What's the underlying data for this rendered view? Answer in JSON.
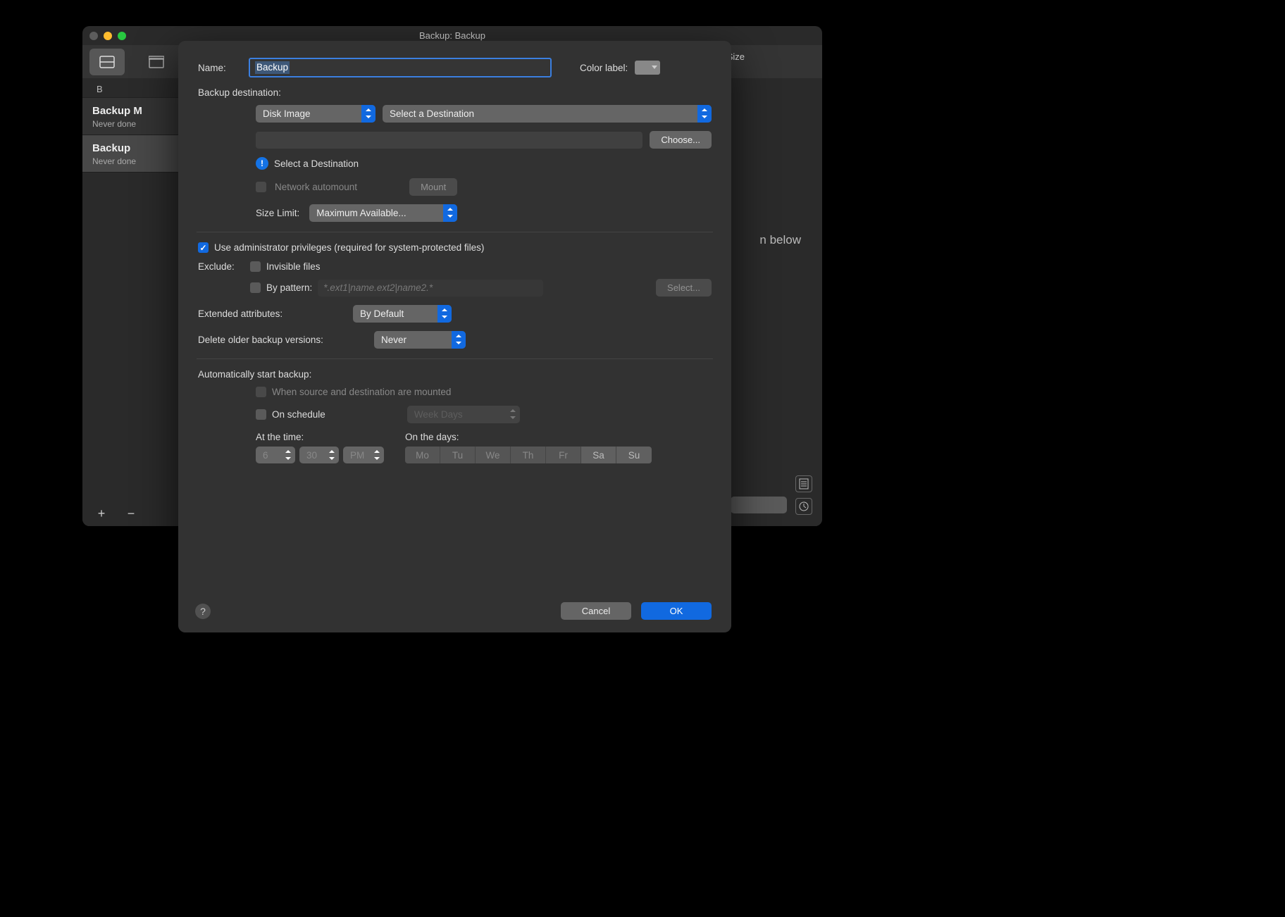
{
  "window": {
    "title": "Backup: Backup",
    "size_column_label": "Size"
  },
  "sidebar": {
    "header": "B",
    "items": [
      {
        "title": "Backup M",
        "subtitle": "Never done"
      },
      {
        "title": "Backup",
        "subtitle": "Never done"
      }
    ]
  },
  "background": {
    "partial_text": "n below"
  },
  "form": {
    "name_label": "Name:",
    "name_value": "Backup",
    "color_label_text": "Color label:",
    "dest_section": "Backup destination:",
    "dest_type": "Disk Image",
    "dest_select": "Select a Destination",
    "choose_btn": "Choose...",
    "dest_warning": "Select a Destination",
    "net_automount": "Network automount",
    "mount_btn": "Mount",
    "size_limit_label": "Size Limit:",
    "size_limit_value": "Maximum Available...",
    "admin_priv": "Use administrator privileges (required for system-protected files)",
    "exclude_label": "Exclude:",
    "invisible_files": "Invisible files",
    "by_pattern": "By pattern:",
    "pattern_placeholder": "*.ext1|name.ext2|name2.*",
    "select_btn": "Select...",
    "ext_attr_label": "Extended attributes:",
    "ext_attr_value": "By Default",
    "delete_older_label": "Delete older backup versions:",
    "delete_older_value": "Never",
    "auto_start_section": "Automatically start backup:",
    "when_mounted": "When source and destination are mounted",
    "on_schedule": "On schedule",
    "schedule_type": "Week Days",
    "at_time_label": "At the time:",
    "on_days_label": "On the days:",
    "time_hour": "6",
    "time_min": "30",
    "time_ampm": "PM",
    "days": [
      "Mo",
      "Tu",
      "We",
      "Th",
      "Fr",
      "Sa",
      "Su"
    ],
    "cancel_btn": "Cancel",
    "ok_btn": "OK"
  }
}
